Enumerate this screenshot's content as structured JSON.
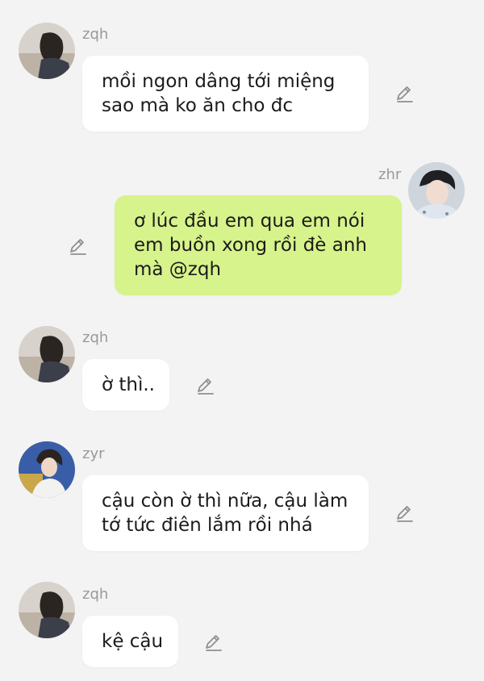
{
  "colors": {
    "background": "#f3f3f3",
    "incoming_bubble": "#ffffff",
    "outgoing_bubble": "#d7f38b",
    "sender_name": "#9a9a9a",
    "message_text": "#1b1b1b",
    "icon": "#8f8f8f"
  },
  "messages": [
    {
      "sender": "zqh",
      "direction": "incoming",
      "lines": [
        "mồi ngon dâng tới miệng",
        "sao mà ko ăn cho đc"
      ],
      "icon": "edit-pencil-icon"
    },
    {
      "sender": "zhr",
      "direction": "outgoing",
      "lines": [
        "ơ lúc đầu em qua em nói",
        "em buồn xong rồi đè anh",
        "mà @zqh"
      ],
      "icon": "edit-pencil-icon"
    },
    {
      "sender": "zqh",
      "direction": "incoming",
      "lines": [
        "ờ thì.."
      ],
      "icon": "edit-pencil-icon"
    },
    {
      "sender": "zyr",
      "direction": "incoming",
      "lines": [
        "cậu còn ờ thì nữa, cậu làm",
        "tớ tức điên lắm rồi nhá"
      ],
      "icon": "edit-pencil-icon"
    },
    {
      "sender": "zqh",
      "direction": "incoming",
      "lines": [
        "kệ cậu"
      ],
      "icon": "edit-pencil-icon"
    }
  ]
}
